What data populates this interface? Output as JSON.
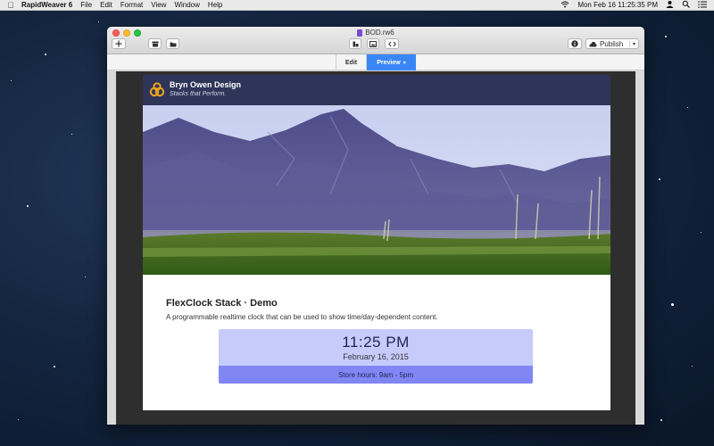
{
  "menubar": {
    "app_name": "RapidWeaver 6",
    "menus": [
      "File",
      "Edit",
      "Format",
      "View",
      "Window",
      "Help"
    ],
    "clock": "Mon Feb 16  11:25:35 PM"
  },
  "window": {
    "doc_title": "BOD.rw6",
    "publish_label": "Publish",
    "modes": {
      "edit": "Edit",
      "preview": "Preview"
    }
  },
  "site": {
    "name": "Bryn Owen Design",
    "tagline": "Stacks that Perform."
  },
  "demo": {
    "title": "FlexClock Stack · Demo",
    "description": "A programmable realtime clock that can be used to show time/day-dependent content.",
    "time": "11:25 PM",
    "date": "February 16, 2015",
    "store_hours": "Store hours: 9am - 5pm"
  },
  "colors": {
    "site_header": "#2f3558",
    "clock_top": "#c6cbfc",
    "clock_bottom": "#8087f5",
    "preview_accent": "#3b86f7"
  }
}
